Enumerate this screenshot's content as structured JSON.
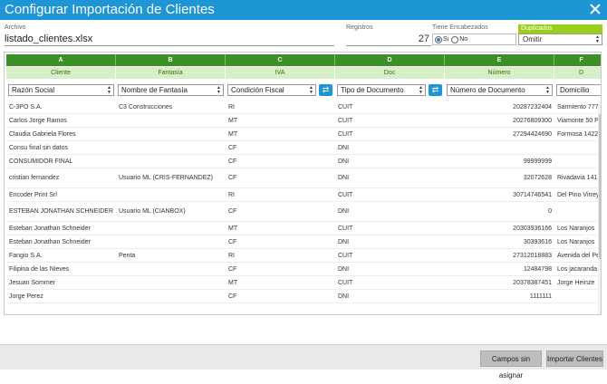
{
  "window": {
    "title": "Configurar Importación de Clientes"
  },
  "fields": {
    "file_label": "Archivo",
    "file_value": "listado_clientes.xlsx",
    "registros_label": "Registros",
    "registros_value": "27",
    "encabezados_label": "Tiene Encabezados",
    "si_label": "Si",
    "no_label": "No",
    "encabezados_selected": "Si",
    "duplicados_label": "Duplicados",
    "duplicados_value": "Omitir"
  },
  "grid": {
    "columns": [
      {
        "letter": "A",
        "name": "Cliente",
        "mapping": "Razón Social"
      },
      {
        "letter": "B",
        "name": "Fantasía",
        "mapping": "Nombre de Fantasía"
      },
      {
        "letter": "C",
        "name": "IVA",
        "mapping": "Condición Fiscal"
      },
      {
        "letter": "D",
        "name": "Doc",
        "mapping": "Tipo de Documento"
      },
      {
        "letter": "E",
        "name": "Número",
        "mapping": "Número de Documento"
      },
      {
        "letter": "F",
        "name": "D",
        "mapping": "Domicilio"
      }
    ],
    "rows": [
      [
        "C-3PO S.A.",
        "C3 Construcciones",
        "RI",
        "CUIT",
        "20287232404",
        "Sarmiento 777"
      ],
      [
        "Carlos Jorge Ramos",
        "",
        "MT",
        "CUIT",
        "20276809300",
        "Viamonte 50 P"
      ],
      [
        "Claudia Gabriela Flores",
        "",
        "MT",
        "CUIT",
        "27294424690",
        "Formosa 1422"
      ],
      [
        "Consu final sin datos",
        "",
        "CF",
        "DNI",
        "",
        ""
      ],
      [
        "CONSUMIDOR FINAL",
        "",
        "CF",
        "DNI",
        "99999999",
        ""
      ],
      [
        "cristian fernandez",
        "Usuario ML (CRIS-FERNANDEZ)",
        "CF",
        "DNI",
        "32072628",
        "Rivadavia 141"
      ],
      [
        "Encoder Print Srl",
        "",
        "RI",
        "CUIT",
        "30714746541",
        "Del Pino Virrey"
      ],
      [
        "ESTEBAN JONATHAN SCHNEIDER",
        "Usuario ML (CIANBOX)",
        "CF",
        "DNI",
        "0",
        ""
      ],
      [
        "Esteban Jonathan Schneider",
        "",
        "MT",
        "CUIT",
        "20303936166",
        "Los Naranjos"
      ],
      [
        "Esteban Jonathan Schneider",
        "",
        "CF",
        "DNI",
        "30393616",
        "Los Naranjos"
      ],
      [
        "Fangio S.A.",
        "Penta",
        "RI",
        "CUIT",
        "27312018883",
        "Avenida del Pe"
      ],
      [
        "Filipina de las Nieves",
        "",
        "CF",
        "DNI",
        "12484798",
        "Los jacaranda"
      ],
      [
        "Jesuan Sommer",
        "",
        "MT",
        "CUIT",
        "20378387451",
        "Jorge Heinze"
      ],
      [
        "Jorge Perez",
        "",
        "CF",
        "DNI",
        "1111111",
        ""
      ]
    ]
  },
  "footer": {
    "unassigned_button": "Campos sin asignar",
    "import_button": "Importar Clientes"
  }
}
